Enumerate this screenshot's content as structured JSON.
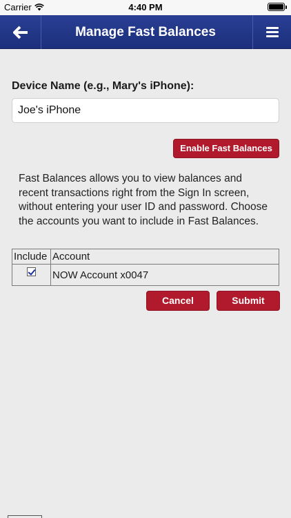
{
  "status_bar": {
    "carrier": "Carrier",
    "time": "4:40 PM",
    "wifi_icon": "wifi-icon",
    "battery_icon": "battery-icon"
  },
  "header": {
    "title": "Manage Fast Balances",
    "back_icon": "back-arrow-icon",
    "menu_icon": "hamburger-menu-icon",
    "background_color": "#22378a"
  },
  "form": {
    "device_label": "Device Name (e.g., Mary's iPhone):",
    "device_value": "Joe's iPhone",
    "enable_label": "Enable Fast Balances",
    "description": "Fast Balances allows you to view balances and recent transactions right from the Sign In screen, without entering your user ID and password. Choose the accounts you want to include in Fast Balances."
  },
  "table": {
    "headers": [
      "Include",
      "Account"
    ],
    "rows": [
      {
        "included": true,
        "account": "NOW Account x0047"
      }
    ]
  },
  "actions": {
    "cancel_label": "Cancel",
    "submit_label": "Submit",
    "button_color": "#b11a2c"
  }
}
